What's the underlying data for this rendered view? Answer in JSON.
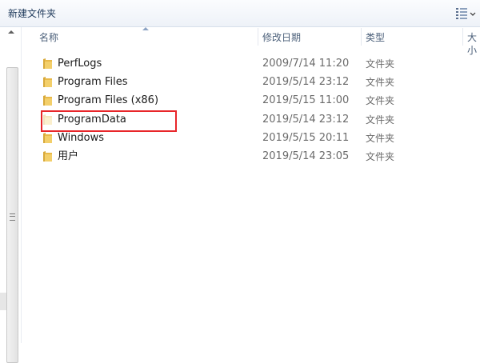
{
  "toolbar": {
    "new_folder_label": "新建文件夹"
  },
  "columns": {
    "name": "名称",
    "date": "修改日期",
    "type": "类型",
    "size": "大小"
  },
  "files": [
    {
      "name": "PerfLogs",
      "date": "2009/7/14 11:20",
      "type": "文件夹"
    },
    {
      "name": "Program Files",
      "date": "2019/5/14 23:12",
      "type": "文件夹"
    },
    {
      "name": "Program Files (x86)",
      "date": "2019/5/15 11:00",
      "type": "文件夹"
    },
    {
      "name": "ProgramData",
      "date": "2019/5/14 23:12",
      "type": "文件夹"
    },
    {
      "name": "Windows",
      "date": "2019/5/15 20:11",
      "type": "文件夹"
    },
    {
      "name": "用户",
      "date": "2019/5/14 23:05",
      "type": "文件夹"
    }
  ],
  "highlight_color": "#e8262a",
  "icons": {
    "folder": "folder-icon",
    "view": "view-options-icon"
  }
}
